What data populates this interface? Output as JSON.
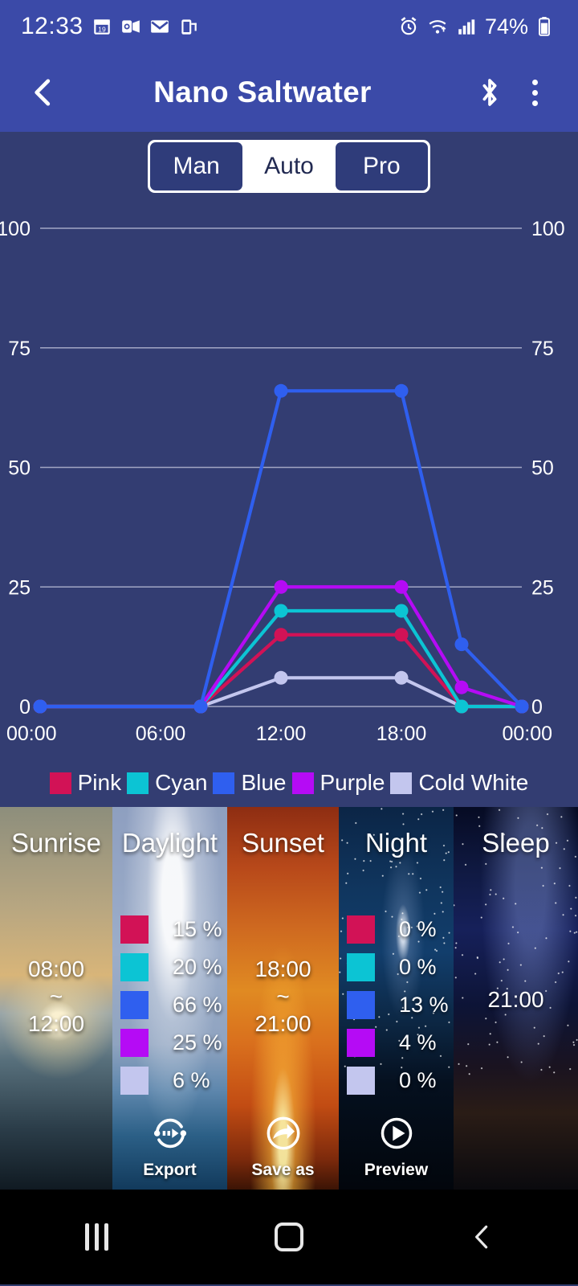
{
  "status_bar": {
    "time": "12:33",
    "left_icons": [
      "calendar-icon",
      "outlook-icon",
      "mail-icon",
      "phone-link-icon"
    ],
    "right_icons": [
      "alarm-icon",
      "wifi-icon",
      "signal-icon"
    ],
    "battery_percent": "74%"
  },
  "app_bar": {
    "back_icon": "back-chevron-icon",
    "title": "Nano Saltwater",
    "bluetooth_icon": "bluetooth-icon",
    "overflow_icon": "more-vertical-icon"
  },
  "mode_selector": {
    "options": [
      {
        "label": "Man",
        "selected": false
      },
      {
        "label": "Auto",
        "selected": true
      },
      {
        "label": "Pro",
        "selected": false
      }
    ]
  },
  "chart_data": {
    "type": "line",
    "title": "",
    "xlabel": "",
    "ylabel": "",
    "ylim": [
      0,
      100
    ],
    "y_ticks": [
      0,
      25,
      50,
      75,
      100
    ],
    "y_ticks_left": [
      "0",
      "25",
      "50",
      "75",
      "100"
    ],
    "y_ticks_right": [
      "0",
      "25",
      "50",
      "75",
      "100"
    ],
    "x_ticks": [
      "00:00",
      "06:00",
      "12:00",
      "18:00",
      "00:00"
    ],
    "x_hours": [
      0,
      6,
      12,
      18,
      24
    ],
    "xlim": [
      0,
      24
    ],
    "grid": true,
    "legend_position": "bottom",
    "series": [
      {
        "name": "Pink",
        "color": "#d21256",
        "x": [
          0,
          8,
          12,
          18,
          21,
          24
        ],
        "values": [
          0,
          0,
          15,
          15,
          0,
          0
        ]
      },
      {
        "name": "Cyan",
        "color": "#0cc4d4",
        "x": [
          0,
          8,
          12,
          18,
          21,
          24
        ],
        "values": [
          0,
          0,
          20,
          20,
          0,
          0
        ]
      },
      {
        "name": "Blue",
        "color": "#2f5fef",
        "x": [
          0,
          8,
          12,
          18,
          21,
          24
        ],
        "values": [
          0,
          0,
          66,
          66,
          13,
          0
        ]
      },
      {
        "name": "Purple",
        "color": "#b50bf5",
        "x": [
          0,
          8,
          12,
          18,
          21,
          24
        ],
        "values": [
          0,
          0,
          25,
          25,
          4,
          0
        ]
      },
      {
        "name": "Cold White",
        "color": "#c3c6ee",
        "x": [
          0,
          8,
          12,
          18,
          21,
          24
        ],
        "values": [
          0,
          0,
          6,
          6,
          0,
          0
        ]
      }
    ]
  },
  "cards": [
    {
      "id": "sunrise",
      "title": "Sunrise",
      "start_time": "08:00",
      "separator": "~",
      "end_time": "12:00",
      "values": [],
      "action": null
    },
    {
      "id": "daylight",
      "title": "Daylight",
      "start_time": "",
      "separator": "",
      "end_time": "",
      "values": [
        {
          "channel": "Pink",
          "color": "#d21256",
          "percent": "15 %"
        },
        {
          "channel": "Cyan",
          "color": "#0cc4d4",
          "percent": "20 %"
        },
        {
          "channel": "Blue",
          "color": "#2f5fef",
          "percent": "66 %"
        },
        {
          "channel": "Purple",
          "color": "#b50bf5",
          "percent": "25 %"
        },
        {
          "channel": "Cold White",
          "color": "#c3c6ee",
          "percent": "6 %"
        }
      ],
      "action": {
        "label": "Export",
        "icon": "export-sync-icon"
      }
    },
    {
      "id": "sunset",
      "title": "Sunset",
      "start_time": "18:00",
      "separator": "~",
      "end_time": "21:00",
      "values": [],
      "action": {
        "label": "Save as",
        "icon": "share-arrow-icon"
      }
    },
    {
      "id": "night",
      "title": "Night",
      "start_time": "",
      "separator": "",
      "end_time": "",
      "values": [
        {
          "channel": "Pink",
          "color": "#d21256",
          "percent": "0 %"
        },
        {
          "channel": "Cyan",
          "color": "#0cc4d4",
          "percent": "0 %"
        },
        {
          "channel": "Blue",
          "color": "#2f5fef",
          "percent": "13 %"
        },
        {
          "channel": "Purple",
          "color": "#b50bf5",
          "percent": "4 %"
        },
        {
          "channel": "Cold White",
          "color": "#c3c6ee",
          "percent": "0 %"
        }
      ],
      "action": {
        "label": "Preview",
        "icon": "play-circle-icon"
      }
    },
    {
      "id": "sleep",
      "title": "Sleep",
      "start_time": "21:00",
      "separator": "",
      "end_time": "",
      "values": [],
      "action": null
    }
  ],
  "nav_bar": {
    "recent_icon": "recent-apps-icon",
    "home_icon": "home-icon",
    "back_icon": "nav-back-icon"
  },
  "colors": {
    "appbar": "#3b4aa8",
    "panel": "#333d72",
    "grid": "#c8c9e0"
  }
}
